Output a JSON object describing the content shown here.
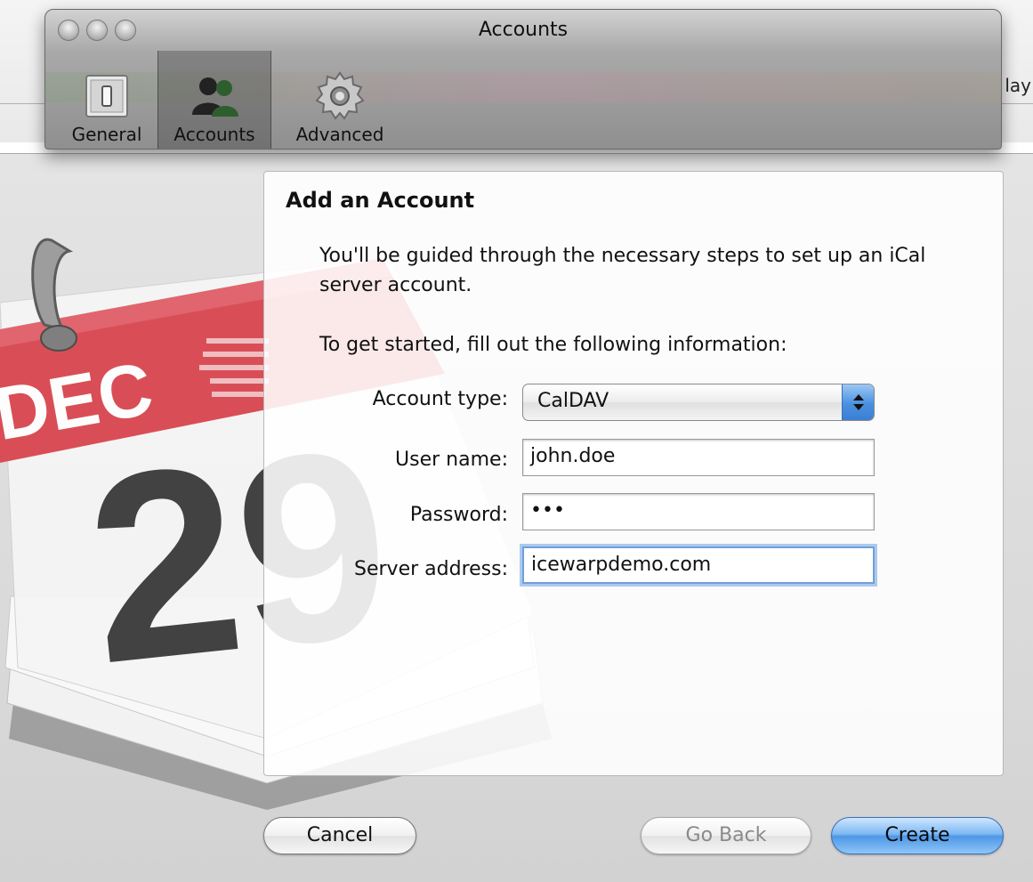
{
  "background": {
    "partial_label": "lay"
  },
  "window": {
    "title": "Accounts"
  },
  "toolbar": {
    "items": [
      {
        "label": "General",
        "icon": "switch-icon",
        "selected": false
      },
      {
        "label": "Accounts",
        "icon": "people-icon",
        "selected": true
      },
      {
        "label": "Advanced",
        "icon": "gear-icon",
        "selected": false
      }
    ]
  },
  "calendar_art": {
    "month": "DEC",
    "day": "29"
  },
  "panel": {
    "title": "Add an Account",
    "intro": "You'll be guided through the necessary steps to set up an iCal server account.",
    "instruction": "To get started, fill out the following information:"
  },
  "form": {
    "account_type_label": "Account type:",
    "account_type_value": "CalDAV",
    "user_name_label": "User name:",
    "user_name_value": "john.doe",
    "password_label": "Password:",
    "password_value": "•••",
    "server_address_label": "Server address:",
    "server_address_value": "icewarpdemo.com"
  },
  "buttons": {
    "cancel": "Cancel",
    "go_back": "Go Back",
    "create": "Create"
  },
  "colors": {
    "accent": "#4f97e6",
    "focus_ring": "#6ea0e0",
    "calendar_red": "#d9474f"
  }
}
